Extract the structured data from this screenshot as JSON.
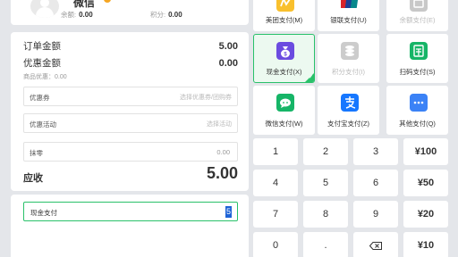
{
  "member": {
    "name": "微信",
    "balance_label": "余额:",
    "balance_value": "0.00",
    "points_label": "积分:",
    "points_value": "0.00"
  },
  "summary": {
    "order_amount_label": "订单金额",
    "order_amount_value": "5.00",
    "discount_amount_label": "优惠金额",
    "discount_amount_value": "0.00",
    "goods_discount_text": "商品优惠：0.00",
    "coupon_label": "优惠券",
    "coupon_placeholder": "选择优惠券/团购券",
    "promotion_label": "优惠活动",
    "promotion_placeholder": "选择活动",
    "rounding_label": "抹零",
    "rounding_value": "0.00",
    "amount_due_label": "应收",
    "amount_due_value": "5.00"
  },
  "payment_input": {
    "label": "现金支付",
    "value": "5"
  },
  "payment_methods": [
    {
      "label": "美团支付(M)",
      "icon": "meituan-icon",
      "color": "#f9c02d",
      "state": "normal"
    },
    {
      "label": "银联支付(U)",
      "icon": "unionpay-icon",
      "color": "#d7242a",
      "state": "normal"
    },
    {
      "label": "余额支付(E)",
      "icon": "balance-icon",
      "color": "#c8c8c8",
      "state": "disabled"
    },
    {
      "label": "现金支付(X)",
      "icon": "cash-icon",
      "color": "#6b4ce0",
      "state": "selected"
    },
    {
      "label": "积分支付(I)",
      "icon": "points-icon",
      "color": "#cccccc",
      "state": "disabled"
    },
    {
      "label": "扫码支付(S)",
      "icon": "qrcode-icon",
      "color": "#16b567",
      "state": "normal"
    },
    {
      "label": "微信支付(W)",
      "icon": "wechat-icon",
      "color": "#16b567",
      "state": "normal"
    },
    {
      "label": "支付宝支付(Z)",
      "icon": "alipay-icon",
      "color": "#1677ff",
      "state": "normal"
    },
    {
      "label": "其他支付(Q)",
      "icon": "more-icon",
      "color": "#3b82f6",
      "state": "normal"
    }
  ],
  "keypad": {
    "k1": "1",
    "k2": "2",
    "k3": "3",
    "q100": "¥100",
    "k4": "4",
    "k5": "5",
    "k6": "6",
    "q50": "¥50",
    "k7": "7",
    "k8": "8",
    "k9": "9",
    "q20": "¥20",
    "k0": "0",
    "dot": ".",
    "q10": "¥10",
    "backspace_icon": "backspace-icon"
  }
}
